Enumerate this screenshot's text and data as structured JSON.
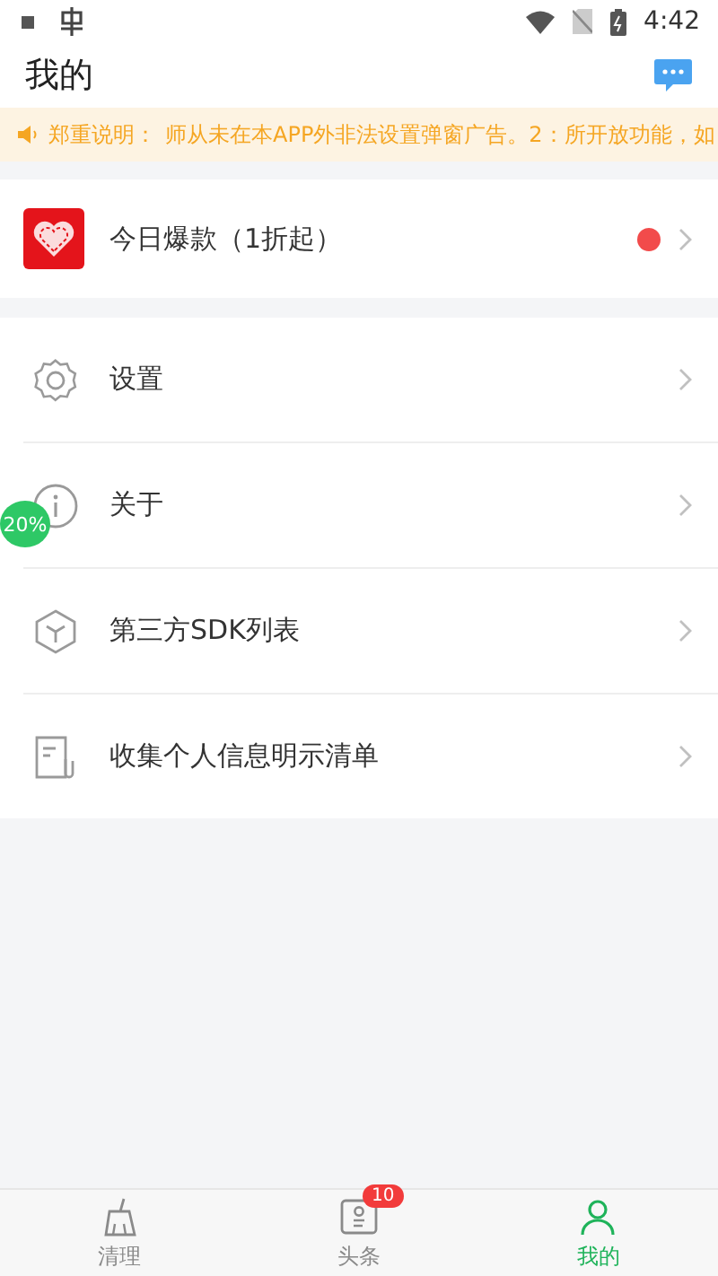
{
  "status_bar": {
    "time": "4:42"
  },
  "header": {
    "title": "我的"
  },
  "notice": {
    "label": "郑重说明：",
    "text": "师从未在本APP外非法设置弹窗广告。2：所开放功能，如"
  },
  "promo": {
    "label": "今日爆款（1折起）",
    "dot": true
  },
  "menu": [
    {
      "kind": "settings",
      "label": "设置"
    },
    {
      "kind": "about",
      "label": "关于"
    },
    {
      "kind": "sdk",
      "label": "第三方SDK列表"
    },
    {
      "kind": "privacy",
      "label": "收集个人信息明示清单"
    }
  ],
  "floating_ball": {
    "text": "20%"
  },
  "tabs": [
    {
      "kind": "clean",
      "label": "清理",
      "selected": false
    },
    {
      "kind": "news",
      "label": "头条",
      "selected": false,
      "badge": "10"
    },
    {
      "kind": "mine",
      "label": "我的",
      "selected": true
    }
  ]
}
